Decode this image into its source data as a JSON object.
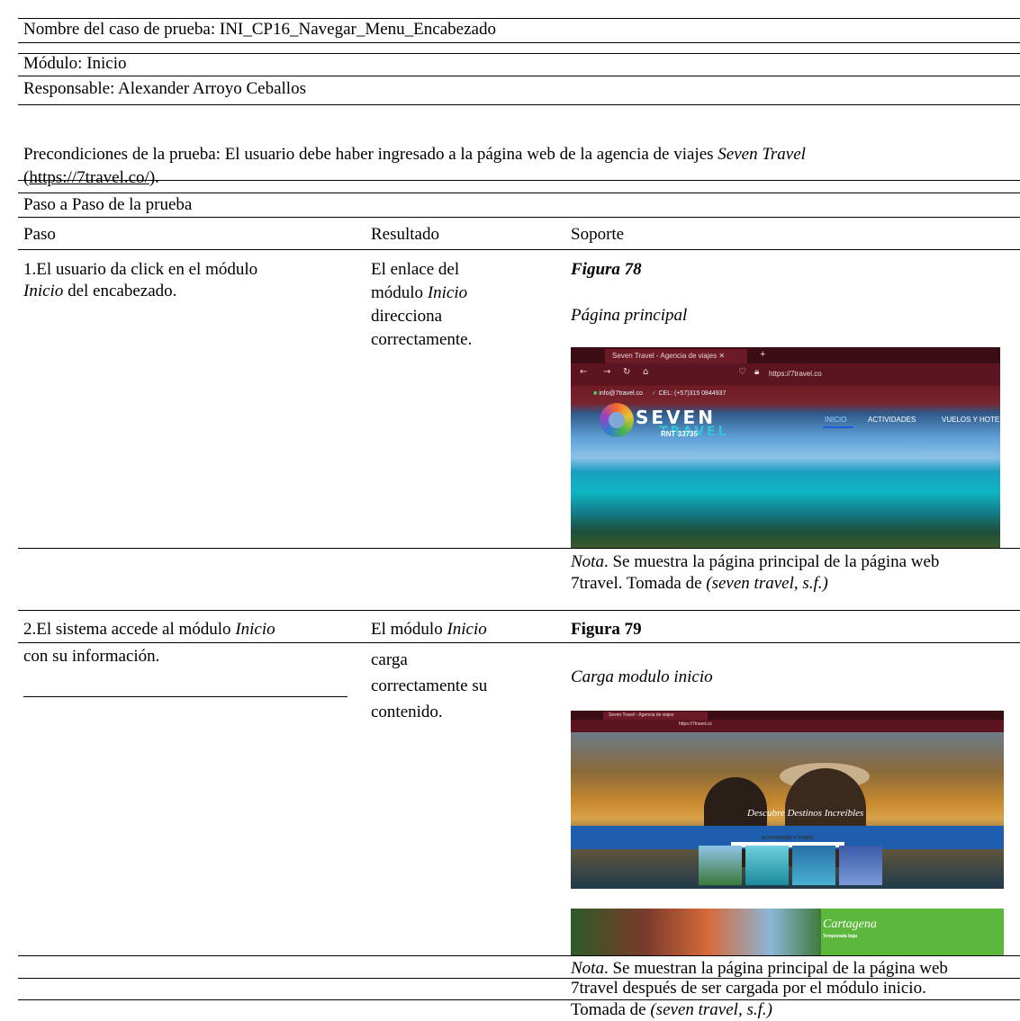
{
  "test_name": "Nombre del caso de prueba: INI_CP16_Navegar_Menu_Encabezado",
  "module": "Módulo: Inicio",
  "responsible": "Responsable: Alexander Arroyo Ceballos",
  "preconditions": {
    "text": "Precondiciones de la prueba: El usuario debe haber ingresado a la página web de la agencia de viajes ",
    "agency": "Seven Travel",
    "open_paren": "(",
    "url": "https://7travel.co/",
    "close": ")."
  },
  "steps_title": "Paso a Paso de la prueba",
  "headers": {
    "step": "Paso",
    "result": "Resultado",
    "support": "Soporte"
  },
  "step1": {
    "line1": "1.El usuario da click en el módulo",
    "line2_italic": "Inicio",
    "line2_rest": " del encabezado.",
    "result_line1": "El enlace del",
    "result_line2a": "módulo ",
    "result_line2b": "Inicio",
    "result_line3": "direcciona",
    "result_line4": "correctamente.",
    "figure_label": "Figura 78",
    "figure_title": "Página principal",
    "note_label": "Nota",
    "note_line1": ". Se muestra la página principal de la página web",
    "note_line2a": "7travel. Tomada de ",
    "note_line2b": "(seven travel, s.f.)"
  },
  "step2": {
    "line1a": "2.El sistema accede al módulo ",
    "line1b": "Inicio",
    "line2": "con su información.",
    "result_line1a": "El módulo ",
    "result_line1b": "Inicio",
    "result_line2": "carga",
    "result_line3": "correctamente su",
    "result_line4": "contenido.",
    "figure_label": "Figura 79",
    "figure_title": "Carga modulo inicio",
    "note_label": "Nota",
    "note_line1": ". Se muestran la página principal de la página web",
    "note_line2": "7travel después de ser cargada por el módulo inicio.",
    "note_line3a": "Tomada de ",
    "note_line3b": "(seven travel, s.f.)"
  },
  "screenshot1": {
    "tab": "Seven Travel - Agencia de viajes",
    "close": "✕",
    "plus": "+",
    "url": "https://7travel.co",
    "email": "info@7travel.co",
    "phone": "CEL: (+57)315 0844937",
    "logo_seven": "SEVEN",
    "logo_travel": "TRAVEL",
    "logo_rnt": "RNT 33735",
    "nav_inicio": "INICIO",
    "nav_actividades": "ACTIVIDADES",
    "nav_vuelos": "VUELOS Y HOTE"
  },
  "screenshot2": {
    "tab": "Seven Travel - Agencia de viajes",
    "url": "https://7travel.co",
    "hero_text": "Descubre Destinos Increíbles",
    "actividades": "ACTIVIDADES Y TOURS",
    "banner_title": "Cartagena",
    "banner_sub": "Temporada baja"
  }
}
